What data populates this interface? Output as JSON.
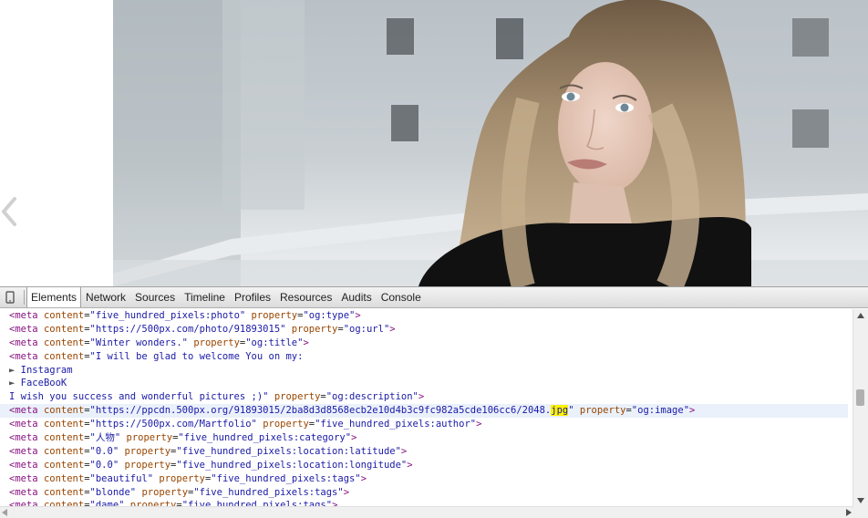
{
  "colors": {
    "tag": "#881280",
    "attr": "#994500",
    "value": "#1a1aa6",
    "highlight": "#fff200"
  },
  "page": {
    "prev_icon": "chevron-left-icon"
  },
  "devtools": {
    "tabs": [
      "Elements",
      "Network",
      "Sources",
      "Timeline",
      "Profiles",
      "Resources",
      "Audits",
      "Console"
    ],
    "active_tab": "Elements",
    "lines": [
      {
        "type": "meta",
        "content": "five_hundred_pixels:photo",
        "property": "og:type"
      },
      {
        "type": "meta",
        "content": "https://500px.com/photo/91893015",
        "property": "og:url"
      },
      {
        "type": "meta",
        "content": "Winter wonders.",
        "property": "og:title"
      },
      {
        "type": "meta-open",
        "content": "I will be glad to welcome You on my:"
      },
      {
        "type": "tri",
        "text": "Instagram"
      },
      {
        "type": "tri",
        "text": "FaceBooK"
      },
      {
        "type": "meta-close",
        "content": "I wish you success and wonderful pictures ;)",
        "property": "og:description"
      },
      {
        "type": "meta-hl",
        "content_pre": "https://ppcdn.500px.org/91893015/2ba8d3d8568ecb2e10d4b3c9fc982a5cde106cc6/2048.",
        "content_hl": "jpg",
        "property": "og:image"
      },
      {
        "type": "meta",
        "content": "https://500px.com/Martfolio",
        "property": "five_hundred_pixels:author"
      },
      {
        "type": "meta",
        "content": "人物",
        "property": "five_hundred_pixels:category"
      },
      {
        "type": "meta",
        "content": "0.0",
        "property": "five_hundred_pixels:location:latitude"
      },
      {
        "type": "meta",
        "content": "0.0",
        "property": "five_hundred_pixels:location:longitude"
      },
      {
        "type": "meta",
        "content": "beautiful",
        "property": "five_hundred_pixels:tags"
      },
      {
        "type": "meta",
        "content": "blonde",
        "property": "five_hundred_pixels:tags"
      },
      {
        "type": "meta",
        "content": "dame",
        "property": "five_hundred_pixels:tags"
      }
    ],
    "syntax": {
      "meta_open": "<meta",
      "content_attr": "content",
      "property_attr": "property",
      "close": ">",
      "eq": "=",
      "quote": "\"",
      "triangle": "►"
    }
  }
}
